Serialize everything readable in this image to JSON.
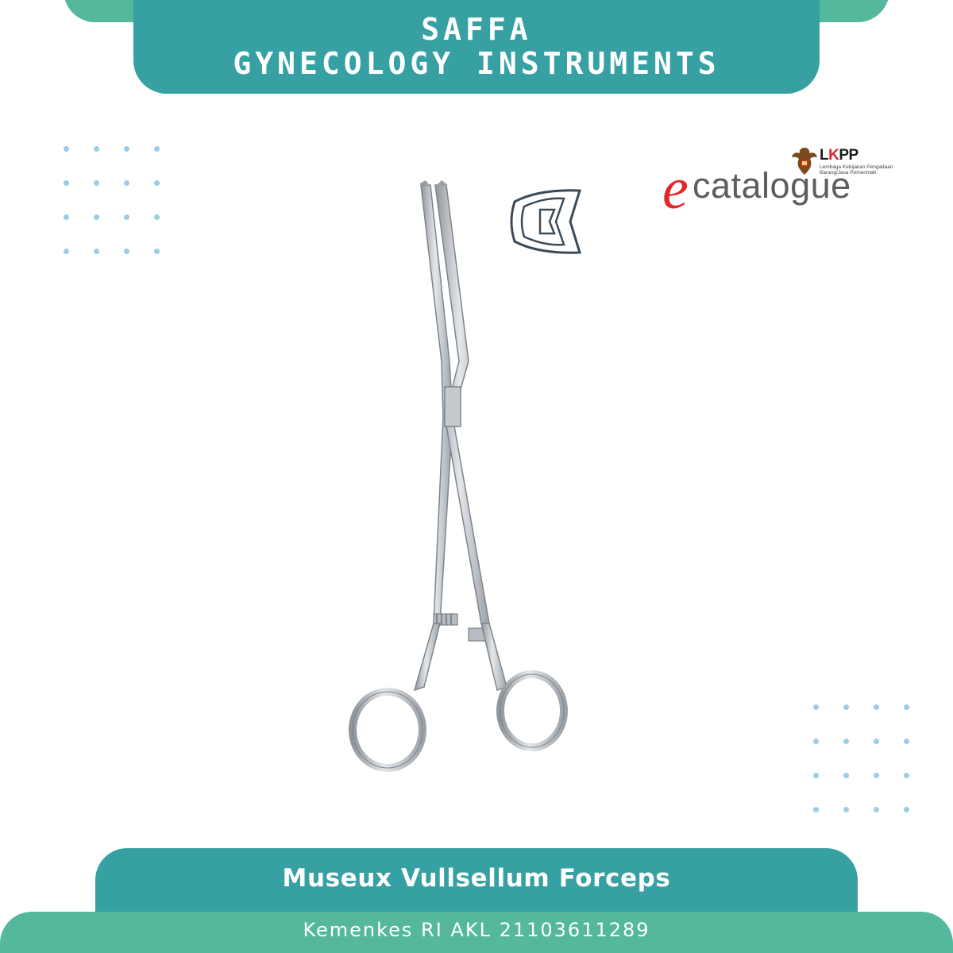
{
  "header": {
    "brand": "SAFFA",
    "subtitle": "GYNECOLOGY INSTRUMENTS"
  },
  "logo": {
    "e_letter": "e",
    "word": "catalogue",
    "org_k": "K",
    "org_rest": "PP",
    "org_l": "L",
    "org_subtitle": "Lembaga Kebijakan Pengadaan Barang/Jasa Pemerintah"
  },
  "product": {
    "name": "Museux Vullsellum Forceps",
    "registration": "Kemenkes RI AKL 21103611289"
  },
  "icons": {
    "instrument": "forceps-image",
    "jaw_profile": "jaw-profile-icon",
    "emblem": "garuda-emblem"
  },
  "colors": {
    "teal": "#36a0a3",
    "green": "#55b89c",
    "dots": "#9ccde4",
    "logo_red": "#e2262b",
    "logo_gray": "#5e5e60"
  }
}
